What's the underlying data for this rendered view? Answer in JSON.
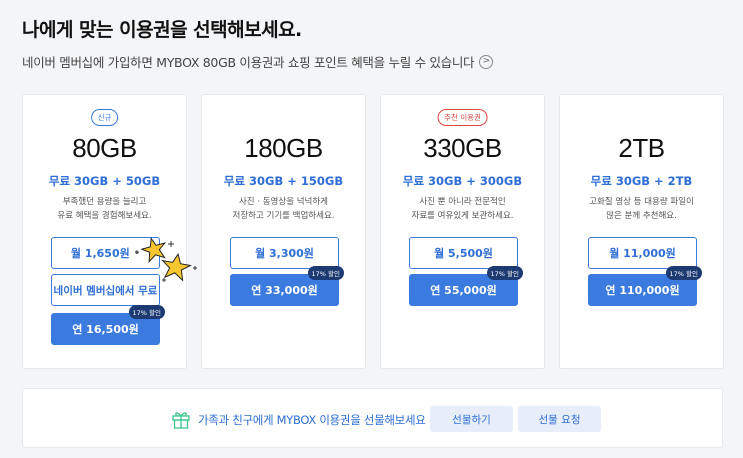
{
  "header": {
    "title": "나에게 맞는 이용권을 선택해보세요.",
    "subtitle": "네이버 멤버십에 가입하면 MYBOX 80GB 이용권과 쇼핑 포인트 혜택을 누릴 수 있습니다",
    "subtitle_chevron": ">"
  },
  "plans": [
    {
      "badge": "신규",
      "capacity": "80GB",
      "free": "무료 30GB + 50GB",
      "desc_line1": "부족했던 용량을 늘리고",
      "desc_line2": "유료 혜택을 경험해보세요.",
      "monthly": "월 1,650원",
      "monthly_dot": "•",
      "membership": "네이버 멤버십에서 무료",
      "yearly": "연 16,500원",
      "discount": "17% 할인"
    },
    {
      "capacity": "180GB",
      "free": "무료 30GB + 150GB",
      "desc_line1": "사진 · 동영상을 넉넉하게",
      "desc_line2": "저장하고 기기를 백업하세요.",
      "monthly": "월 3,300원",
      "yearly": "연 33,000원",
      "discount": "17% 할인"
    },
    {
      "badge": "추천 이용권",
      "capacity": "330GB",
      "free": "무료 30GB + 300GB",
      "desc_line1": "사진 뿐 아니라 전문적인",
      "desc_line2": "자료를 여유있게 보관하세요.",
      "monthly": "월 5,500원",
      "yearly": "연 55,000원",
      "discount": "17% 할인"
    },
    {
      "capacity": "2TB",
      "free": "무료 30GB + 2TB",
      "desc_line1": "고화질 영상 등 대용량 파일이",
      "desc_line2": "많은 분께 추천해요.",
      "monthly": "월 11,000원",
      "yearly": "연 110,000원",
      "discount": "17% 할인"
    }
  ],
  "gift": {
    "text": "가족과 친구에게 MYBOX 이용권을 선물해보세요",
    "gift_button": "선물하기",
    "request_button": "선물 요청",
    "icon": "gift-icon"
  },
  "colors": {
    "accent": "#3b7be0",
    "free_text": "#2e6ed6",
    "discount_badge": "#1d3a73",
    "new_badge": "#3b7be0",
    "recommend_badge": "#e04545",
    "star": "#f7c631"
  }
}
